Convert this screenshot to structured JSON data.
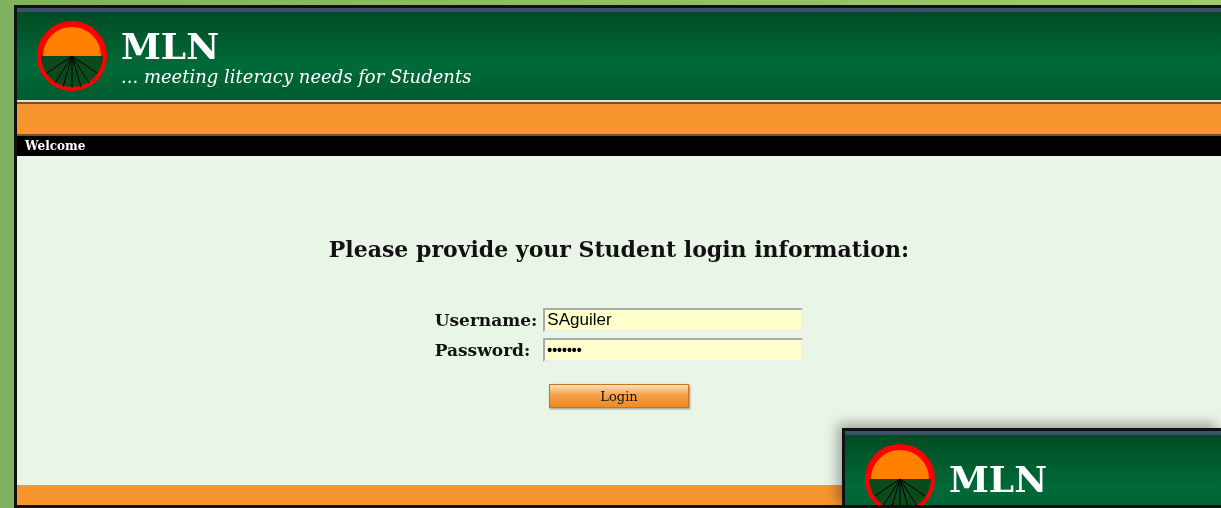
{
  "app": {
    "title": "MLN",
    "tagline": "... meeting literacy needs for Students"
  },
  "nav": {
    "breadcrumb": "Welcome"
  },
  "login": {
    "heading": "Please provide your Student login information:",
    "fields": [
      {
        "label": "Username:",
        "value": "SAguiler",
        "kind": "text"
      },
      {
        "label": "Password:",
        "value": "•••••••",
        "kind": "password"
      }
    ],
    "button": "Login"
  },
  "overlay_window": {
    "title": "MLN"
  }
}
